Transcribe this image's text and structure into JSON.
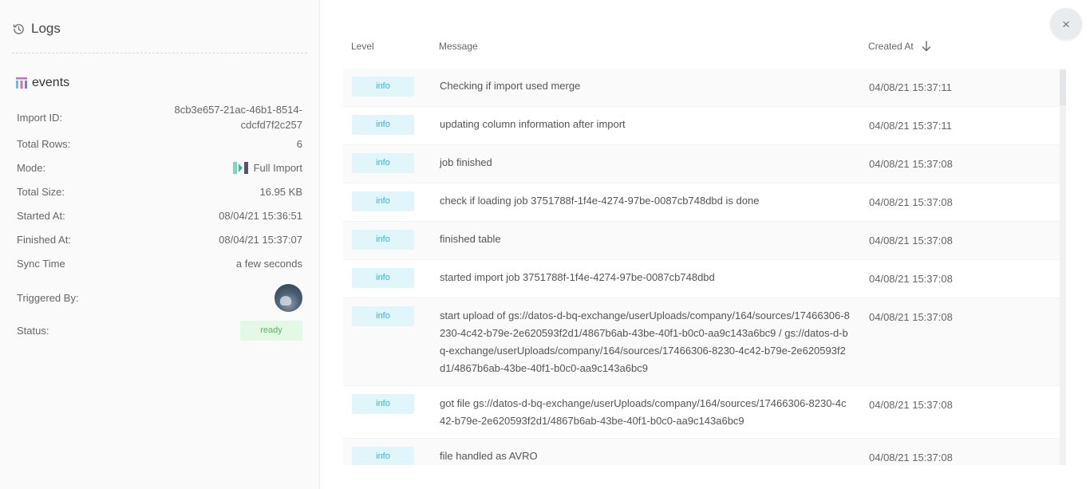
{
  "sidebar": {
    "title": "Logs",
    "table_name": "events",
    "fields": {
      "import_id_label": "Import ID:",
      "import_id_line1": "8cb3e657-21ac-46b1-8514-",
      "import_id_line2": "cdcfd7f2c257",
      "total_rows_label": "Total Rows:",
      "total_rows": "6",
      "mode_label": "Mode:",
      "mode": "Full Import",
      "total_size_label": "Total Size:",
      "total_size": "16.95 KB",
      "started_at_label": "Started At:",
      "started_at": "08/04/21 15:36:51",
      "finished_at_label": "Finished At:",
      "finished_at": "08/04/21 15:37:07",
      "sync_time_label": "Sync Time",
      "sync_time": "a few seconds",
      "triggered_by_label": "Triggered By:",
      "status_label": "Status:",
      "status": "ready"
    }
  },
  "table": {
    "columns": {
      "level": "Level",
      "message": "Message",
      "created_at": "Created At"
    },
    "rows": [
      {
        "level": "info",
        "message": "Checking if import used merge",
        "created_at": "04/08/21 15:37:11"
      },
      {
        "level": "info",
        "message": "updating column information after import",
        "created_at": "04/08/21 15:37:11"
      },
      {
        "level": "info",
        "message": "job finished",
        "created_at": "04/08/21 15:37:08"
      },
      {
        "level": "info",
        "message": "check if loading job 3751788f-1f4e-4274-97be-0087cb748dbd is done",
        "created_at": "04/08/21 15:37:08"
      },
      {
        "level": "info",
        "message": "finished table",
        "created_at": "04/08/21 15:37:08"
      },
      {
        "level": "info",
        "message": "started import job 3751788f-1f4e-4274-97be-0087cb748dbd",
        "created_at": "04/08/21 15:37:08"
      },
      {
        "level": "info",
        "message": "start upload of gs://datos-d-bq-exchange/userUploads/company/164/sources/17466306-8230-4c42-b79e-2e620593f2d1/4867b6ab-43be-40f1-b0c0-aa9c143a6bc9 / gs://datos-d-bq-exchange/userUploads/company/164/sources/17466306-8230-4c42-b79e-2e620593f2d1/4867b6ab-43be-40f1-b0c0-aa9c143a6bc9",
        "created_at": "04/08/21 15:37:08"
      },
      {
        "level": "info",
        "message": "got file gs://datos-d-bq-exchange/userUploads/company/164/sources/17466306-8230-4c42-b79e-2e620593f2d1/4867b6ab-43be-40f1-b0c0-aa9c143a6bc9",
        "created_at": "04/08/21 15:37:08"
      },
      {
        "level": "info",
        "message": "file handled as AVRO",
        "created_at": "04/08/21 15:37:08"
      }
    ]
  },
  "close_label": "×",
  "colors": {
    "info_badge_bg": "#e1f6fa",
    "info_badge_text": "#31b7d6",
    "ready_badge_bg": "#e3f8e5",
    "ready_badge_text": "#57b864"
  },
  "icons": {
    "logs": "history-icon",
    "table": "table-icon",
    "mode": "full-import-icon",
    "sort": "arrow-down-icon",
    "close": "close-icon"
  }
}
